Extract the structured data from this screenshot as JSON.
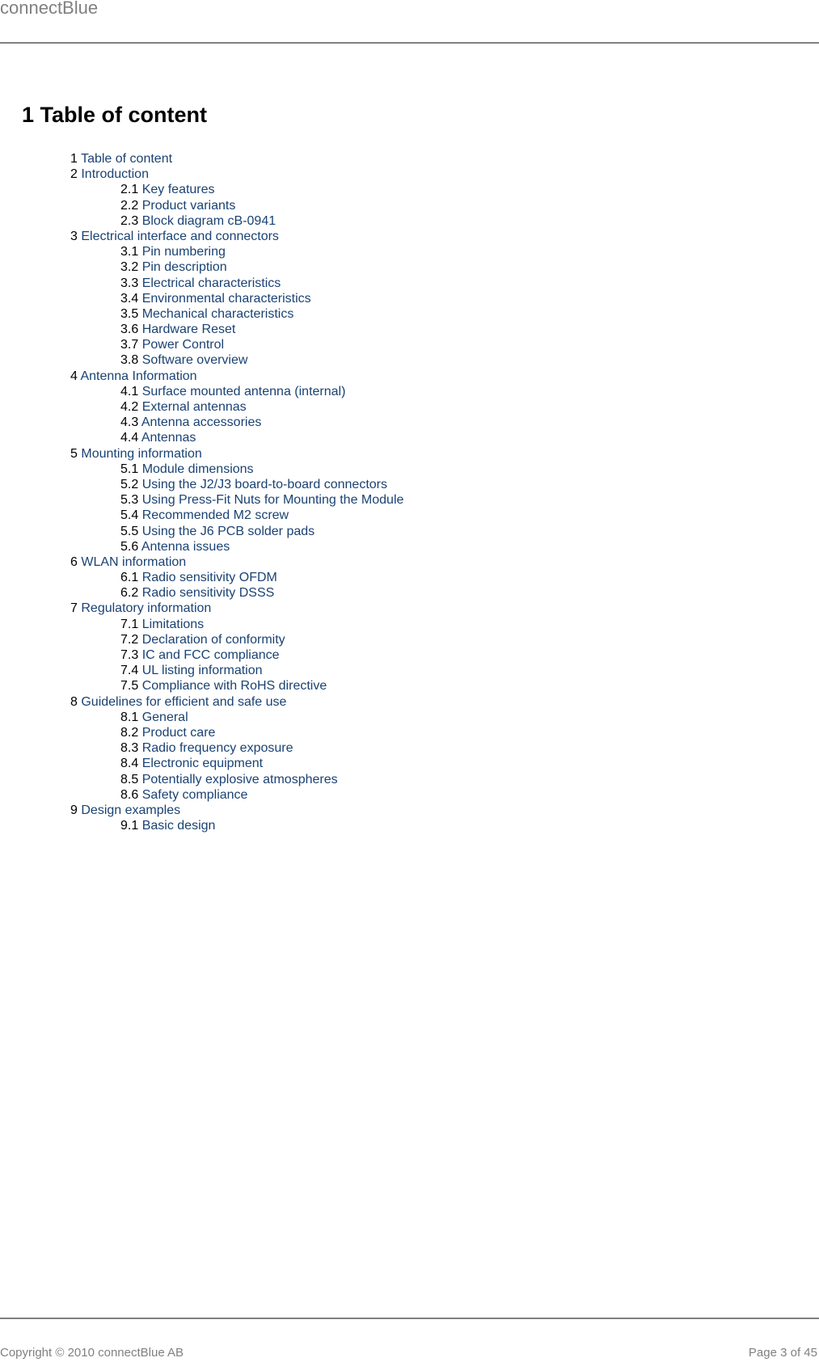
{
  "header": {
    "brand": "connectBlue"
  },
  "page_title": "1 Table of content",
  "toc": [
    {
      "num": "1",
      "label": "Table of content",
      "level": 1
    },
    {
      "num": "2",
      "label": "Introduction",
      "level": 1
    },
    {
      "num": "2.1",
      "label": "Key features",
      "level": 2
    },
    {
      "num": "2.2",
      "label": "Product variants",
      "level": 2
    },
    {
      "num": "2.3",
      "label": "Block diagram cB-0941",
      "level": 2
    },
    {
      "num": "3",
      "label": "Electrical interface and connectors",
      "level": 1
    },
    {
      "num": "3.1",
      "label": "Pin numbering",
      "level": 2
    },
    {
      "num": "3.2",
      "label": "Pin description",
      "level": 2
    },
    {
      "num": "3.3",
      "label": "Electrical characteristics",
      "level": 2
    },
    {
      "num": "3.4",
      "label": "Environmental characteristics",
      "level": 2
    },
    {
      "num": "3.5",
      "label": "Mechanical characteristics",
      "level": 2
    },
    {
      "num": "3.6",
      "label": "Hardware Reset",
      "level": 2
    },
    {
      "num": "3.7",
      "label": "Power Control",
      "level": 2
    },
    {
      "num": "3.8",
      "label": "Software overview",
      "level": 2
    },
    {
      "num": "4",
      "label": "Antenna Information",
      "level": 1
    },
    {
      "num": "4.1",
      "label": "Surface mounted antenna (internal)",
      "level": 2
    },
    {
      "num": "4.2",
      "label": "External antennas",
      "level": 2
    },
    {
      "num": "4.3",
      "label": "Antenna accessories",
      "level": 2
    },
    {
      "num": "4.4",
      "label": "Antennas",
      "level": 2
    },
    {
      "num": "5",
      "label": "Mounting information",
      "level": 1
    },
    {
      "num": "5.1",
      "label": "Module dimensions",
      "level": 2
    },
    {
      "num": "5.2",
      "label": "Using the J2/J3 board-to-board connectors",
      "level": 2
    },
    {
      "num": "5.3",
      "label": "Using Press-Fit Nuts for Mounting the Module",
      "level": 2
    },
    {
      "num": "5.4",
      "label": "Recommended M2 screw",
      "level": 2
    },
    {
      "num": "5.5",
      "label": "Using the J6 PCB solder pads",
      "level": 2
    },
    {
      "num": "5.6",
      "label": "Antenna issues",
      "level": 2
    },
    {
      "num": "6",
      "label": "WLAN information",
      "level": 1
    },
    {
      "num": "6.1",
      "label": "Radio sensitivity OFDM",
      "level": 2
    },
    {
      "num": "6.2",
      "label": "Radio sensitivity DSSS",
      "level": 2
    },
    {
      "num": "7",
      "label": "Regulatory information",
      "level": 1
    },
    {
      "num": "7.1",
      "label": "Limitations",
      "level": 2
    },
    {
      "num": "7.2",
      "label": "Declaration of conformity",
      "level": 2
    },
    {
      "num": "7.3",
      "label": "IC and FCC compliance",
      "level": 2
    },
    {
      "num": "7.4",
      "label": "UL listing information",
      "level": 2
    },
    {
      "num": "7.5",
      "label": "Compliance with RoHS directive",
      "level": 2
    },
    {
      "num": "8",
      "label": "Guidelines for efficient and safe use",
      "level": 1
    },
    {
      "num": "8.1",
      "label": "General",
      "level": 2
    },
    {
      "num": "8.2",
      "label": "Product care",
      "level": 2
    },
    {
      "num": "8.3",
      "label": "Radio frequency exposure",
      "level": 2
    },
    {
      "num": "8.4",
      "label": "Electronic equipment",
      "level": 2
    },
    {
      "num": "8.5",
      "label": "Potentially explosive atmospheres",
      "level": 2
    },
    {
      "num": "8.6",
      "label": "Safety compliance",
      "level": 2
    },
    {
      "num": "9",
      "label": "Design examples",
      "level": 1
    },
    {
      "num": "9.1",
      "label": "Basic design",
      "level": 2
    }
  ],
  "footer": {
    "copyright": "Copyright © 2010 connectBlue AB",
    "page_indicator": "Page 3 of 45"
  },
  "colors": {
    "link": "#1a4273",
    "header_footer_gray": "#808080"
  }
}
